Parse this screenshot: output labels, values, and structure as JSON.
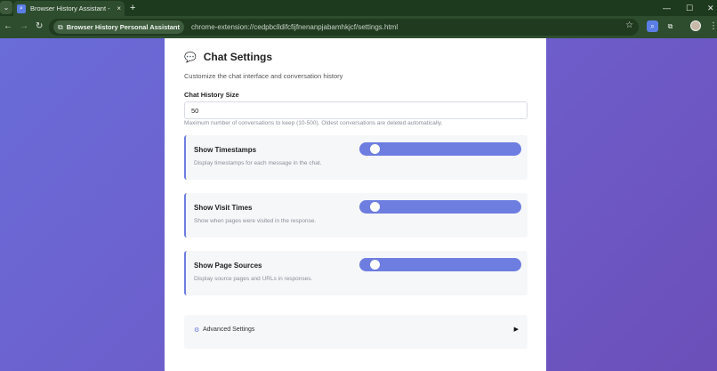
{
  "browser": {
    "tab_title": "Browser History Assistant - Setti",
    "site_chip_label": "Browser History Personal Assistant",
    "url": "chrome-extension://cedpbclldifcfijfnenanpjabamhkjcf/settings.html",
    "new_tab_label": "+",
    "tab_close_label": "×"
  },
  "settings": {
    "title": "Chat Settings",
    "subtitle": "Customize the chat interface and conversation history",
    "history_size": {
      "label": "Chat History Size",
      "value": "50",
      "help": "Maximum number of conversations to keep (10-500). Oldest conversations are deleted automatically."
    },
    "toggles": [
      {
        "title": "Show Timestamps",
        "description": "Display timestamps for each message in the chat."
      },
      {
        "title": "Show Visit Times",
        "description": "Show when pages were visited in the response."
      },
      {
        "title": "Show Page Sources",
        "description": "Display source pages and URLs in responses."
      }
    ],
    "advanced": {
      "label": "Advanced Settings",
      "arrow": "▶"
    }
  },
  "colors": {
    "accent": "#6d7de0",
    "tab_strip": "#1e3a1e",
    "toolbar": "#2e4d2e",
    "background_gradient_start": "#6a6cd8",
    "background_gradient_end": "#6c4fb9"
  },
  "icons": {
    "tab_menu": "chevron-down-icon",
    "favicon": "history-assistant-favicon",
    "back": "back-arrow-icon",
    "forward": "forward-arrow-icon",
    "reload": "reload-icon",
    "site": "extension-puzzle-icon",
    "bookmark": "star-icon",
    "chat": "speech-bubble-icon",
    "advanced": "settings-gear-icon"
  }
}
